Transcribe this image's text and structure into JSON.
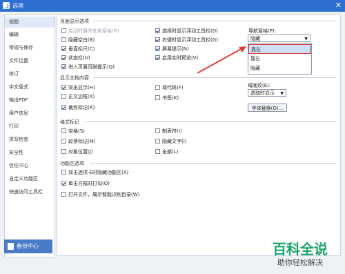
{
  "window": {
    "title": "选项"
  },
  "sidebar": {
    "items": [
      {
        "label": "视图",
        "selected": true
      },
      {
        "label": "编辑"
      },
      {
        "label": "常规与保存"
      },
      {
        "label": "文件位置"
      },
      {
        "label": "修订"
      },
      {
        "label": "中文版式"
      },
      {
        "label": "输出PDF"
      },
      {
        "label": "用户信息"
      },
      {
        "label": "打印"
      },
      {
        "label": "拼写检查"
      },
      {
        "label": "安全性"
      },
      {
        "label": "信任中心"
      },
      {
        "label": "自定义功能区"
      },
      {
        "label": "快速访问工具栏"
      }
    ],
    "backup_label": "备份中心"
  },
  "sections": {
    "page_display": "页面显示选项",
    "show_content": "显示文档内容",
    "format_marks": "格式标记",
    "ribbon_options": "功能区选项"
  },
  "page_display": {
    "col1": [
      {
        "label": "启动时展开任务窗格(R)",
        "checked": false,
        "disabled": true
      },
      {
        "label": "隐藏空白(B)",
        "checked": false
      },
      {
        "label": "垂直标尺(C)",
        "checked": true
      },
      {
        "label": "状态栏(U)",
        "checked": true
      },
      {
        "label": "进入页眉页脚提示(Q)",
        "checked": true
      }
    ],
    "col2": [
      {
        "label": "选择时显示浮动工具栏(D)",
        "checked": true
      },
      {
        "label": "右键时显示浮动工具栏(G)",
        "checked": true
      },
      {
        "label": "屏幕提示(N)",
        "checked": true
      },
      {
        "label": "启用实时预览(V)",
        "checked": true
      }
    ],
    "nav_pane_label": "导航窗格(P):",
    "nav_pane_value": "隐藏",
    "nav_pane_options": [
      "靠左",
      "靠右",
      "隐藏"
    ]
  },
  "show_content": {
    "col1": [
      {
        "label": "突出显示(H)",
        "checked": true
      },
      {
        "label": "正文边框(X)",
        "checked": false
      },
      {
        "label": "裁剪标记(R)",
        "checked": true
      }
    ],
    "col2": [
      {
        "label": "域代码(F)",
        "checked": false
      },
      {
        "label": "书签(K)",
        "checked": false
      }
    ],
    "field_shading_label": "域底纹(E):",
    "field_shading_value": "选取时显示",
    "font_substitute_button": "字体替换(O)..."
  },
  "format_marks": {
    "col1": [
      {
        "label": "空格(S)",
        "checked": false
      },
      {
        "label": "段落标记(M)",
        "checked": false
      },
      {
        "label": "对象位置(J)",
        "checked": false
      }
    ],
    "col2": [
      {
        "label": "制表符(I)",
        "checked": false
      },
      {
        "label": "隐藏文字(I)",
        "checked": false
      },
      {
        "label": "全部(L)",
        "checked": false
      }
    ]
  },
  "ribbon_options": {
    "items": [
      {
        "label": "双击选项卡时隐藏功能区(A)",
        "checked": false
      },
      {
        "label": "单击方框时打勾(O)",
        "checked": true
      },
      {
        "label": "打开文件，展示智能识别目录(W)",
        "checked": false
      }
    ]
  },
  "watermark": {
    "title": "百科全说",
    "subtitle": "助你轻松解决"
  },
  "colors": {
    "accent": "#2c6fd1",
    "highlight": "#e23b3b",
    "watermark": "#1aa36b"
  }
}
